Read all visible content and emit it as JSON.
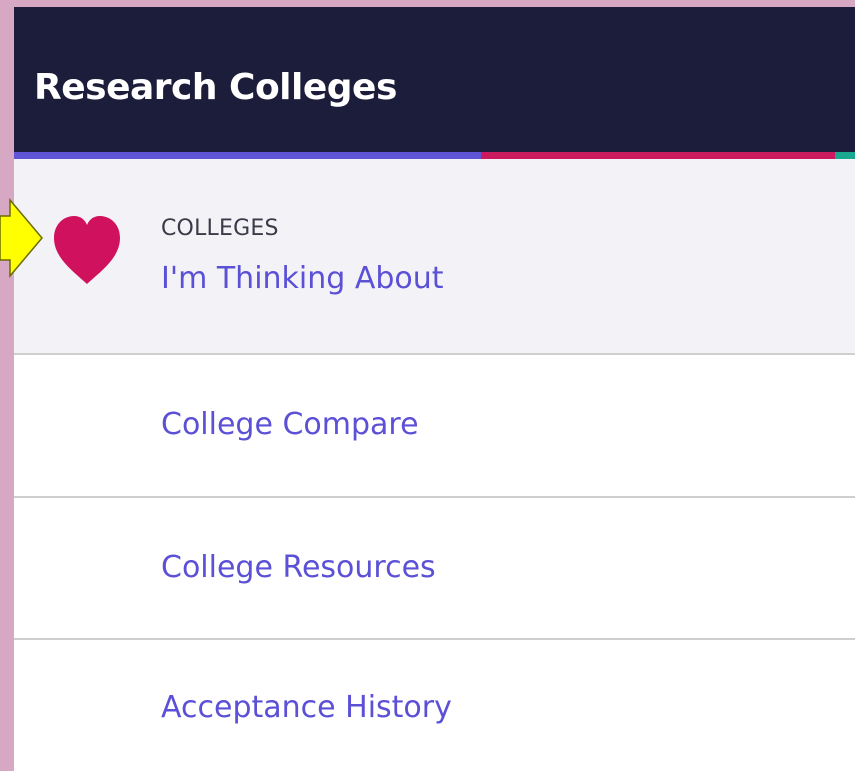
{
  "header": {
    "title": "Research Colleges"
  },
  "colors": {
    "page_background": "#d6a8c3",
    "header_background": "#1c1d3a",
    "accent_stripe": [
      "#5f55d6",
      "#cc1a5e",
      "#1aa891"
    ],
    "link": "#5b50d6",
    "heart": "#d0115e",
    "pointer_arrow": "#ffff00"
  },
  "nav": {
    "active": {
      "icon": "heart-icon",
      "eyebrow": "COLLEGES",
      "label": "I'm Thinking About"
    },
    "items": [
      {
        "label": "College Compare"
      },
      {
        "label": "College Resources"
      },
      {
        "label": "Acceptance History"
      }
    ]
  }
}
